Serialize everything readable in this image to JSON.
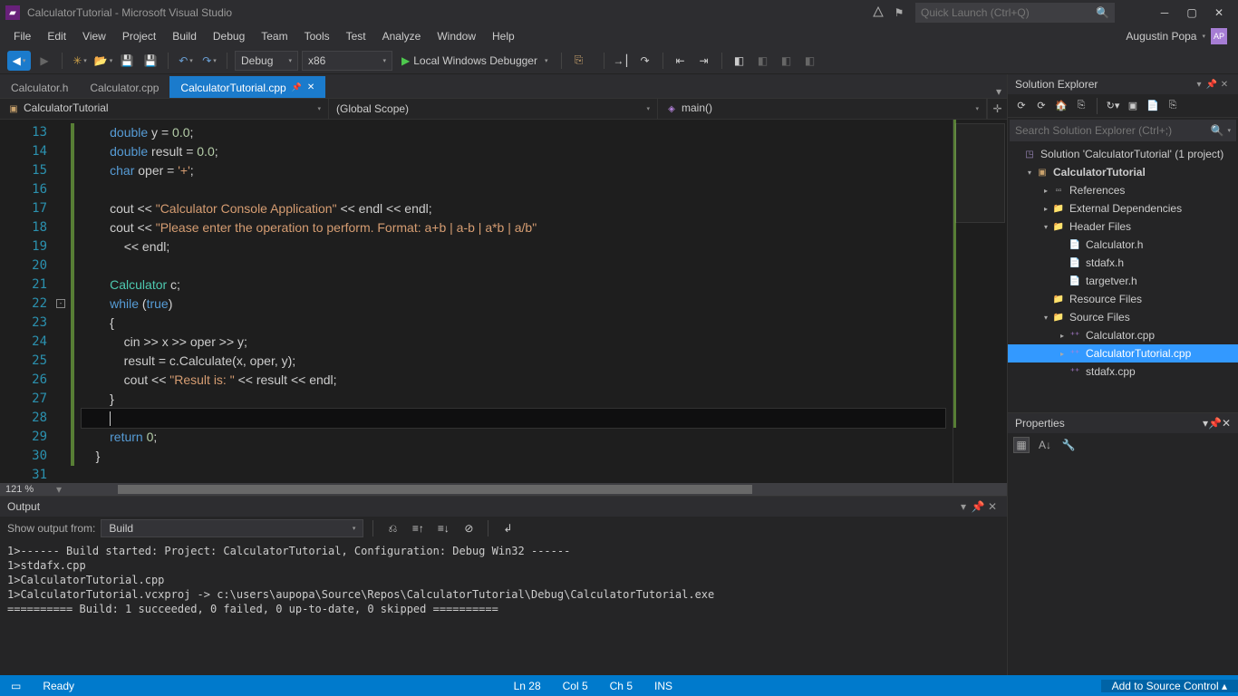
{
  "title": "CalculatorTutorial - Microsoft Visual Studio",
  "quickLaunch": {
    "placeholder": "Quick Launch (Ctrl+Q)"
  },
  "user": {
    "name": "Augustin Popa",
    "initials": "AP"
  },
  "menu": [
    "File",
    "Edit",
    "View",
    "Project",
    "Build",
    "Debug",
    "Team",
    "Tools",
    "Test",
    "Analyze",
    "Window",
    "Help"
  ],
  "toolbar": {
    "config": "Debug",
    "platform": "x86",
    "run": "Local Windows Debugger"
  },
  "tabs": [
    {
      "label": "Calculator.h",
      "active": false
    },
    {
      "label": "Calculator.cpp",
      "active": false
    },
    {
      "label": "CalculatorTutorial.cpp",
      "active": true
    }
  ],
  "nav": {
    "scope1": "CalculatorTutorial",
    "scope2": "(Global Scope)",
    "scope3": "main()"
  },
  "code": {
    "startLine": 13,
    "currentLine": 28,
    "lines": [
      {
        "n": 13,
        "mod": true,
        "html": "        <span class='kw'>double</span> y <span class='pl'>=</span> <span class='nm'>0.0</span><span class='pl'>;</span>"
      },
      {
        "n": 14,
        "mod": true,
        "html": "        <span class='kw'>double</span> result <span class='pl'>=</span> <span class='nm'>0.0</span><span class='pl'>;</span>"
      },
      {
        "n": 15,
        "mod": true,
        "html": "        <span class='kw'>char</span> oper <span class='pl'>=</span> <span class='st'>'+'</span><span class='pl'>;</span>"
      },
      {
        "n": 16,
        "mod": true,
        "html": ""
      },
      {
        "n": 17,
        "mod": true,
        "html": "        cout <span class='pl'>&lt;&lt;</span> <span class='st'>\"Calculator Console Application\"</span> <span class='pl'>&lt;&lt;</span> endl <span class='pl'>&lt;&lt;</span> endl<span class='pl'>;</span>"
      },
      {
        "n": 18,
        "mod": true,
        "html": "        cout <span class='pl'>&lt;&lt;</span> <span class='st'>\"Please enter the operation to perform. Format: a+b | a-b | a*b | a/b\"</span>"
      },
      {
        "n": 19,
        "mod": true,
        "html": "            <span class='pl'>&lt;&lt;</span> endl<span class='pl'>;</span>"
      },
      {
        "n": 20,
        "mod": true,
        "html": ""
      },
      {
        "n": 21,
        "mod": true,
        "html": "        <span class='ty'>Calculator</span> c<span class='pl'>;</span>"
      },
      {
        "n": 22,
        "mod": true,
        "fold": true,
        "html": "        <span class='kw'>while</span> <span class='pl'>(</span><span class='kw'>true</span><span class='pl'>)</span>"
      },
      {
        "n": 23,
        "mod": true,
        "html": "        <span class='pl'>{</span>"
      },
      {
        "n": 24,
        "mod": true,
        "html": "            cin <span class='pl'>&gt;&gt;</span> x <span class='pl'>&gt;&gt;</span> oper <span class='pl'>&gt;&gt;</span> y<span class='pl'>;</span>"
      },
      {
        "n": 25,
        "mod": true,
        "html": "            result <span class='pl'>=</span> c<span class='pl'>.</span>Calculate<span class='pl'>(</span>x<span class='pl'>,</span> oper<span class='pl'>,</span> y<span class='pl'>);</span>"
      },
      {
        "n": 26,
        "mod": true,
        "html": "            cout <span class='pl'>&lt;&lt;</span> <span class='st'>\"Result is: \"</span> <span class='pl'>&lt;&lt;</span> result <span class='pl'>&lt;&lt;</span> endl<span class='pl'>;</span>"
      },
      {
        "n": 27,
        "mod": true,
        "html": "        <span class='pl'>}</span>"
      },
      {
        "n": 28,
        "mod": true,
        "cur": true,
        "html": "        <span class='cursor'></span>"
      },
      {
        "n": 29,
        "mod": true,
        "html": "        <span class='kw'>return</span> <span class='nm'>0</span><span class='pl'>;</span>"
      },
      {
        "n": 30,
        "mod": true,
        "html": "    <span class='pl'>}</span>"
      },
      {
        "n": 31,
        "mod": false,
        "html": ""
      }
    ]
  },
  "zoom": "121 %",
  "output": {
    "title": "Output",
    "showFromLabel": "Show output from:",
    "showFrom": "Build",
    "lines": [
      "1>------ Build started: Project: CalculatorTutorial, Configuration: Debug Win32 ------",
      "1>stdafx.cpp",
      "1>CalculatorTutorial.cpp",
      "1>CalculatorTutorial.vcxproj -> c:\\users\\aupopa\\Source\\Repos\\CalculatorTutorial\\Debug\\CalculatorTutorial.exe",
      "========== Build: 1 succeeded, 0 failed, 0 up-to-date, 0 skipped =========="
    ]
  },
  "solutionExplorer": {
    "title": "Solution Explorer",
    "searchPlaceholder": "Search Solution Explorer (Ctrl+;)",
    "tree": [
      {
        "depth": 0,
        "arrow": "",
        "icon": "sln",
        "label": "Solution 'CalculatorTutorial' (1 project)"
      },
      {
        "depth": 1,
        "arrow": "▾",
        "icon": "proj",
        "label": "CalculatorTutorial",
        "bold": true
      },
      {
        "depth": 2,
        "arrow": "▸",
        "icon": "ref",
        "label": "References"
      },
      {
        "depth": 2,
        "arrow": "▸",
        "icon": "folder",
        "label": "External Dependencies"
      },
      {
        "depth": 2,
        "arrow": "▾",
        "icon": "folder",
        "label": "Header Files"
      },
      {
        "depth": 3,
        "arrow": "",
        "icon": "h",
        "label": "Calculator.h"
      },
      {
        "depth": 3,
        "arrow": "",
        "icon": "h",
        "label": "stdafx.h"
      },
      {
        "depth": 3,
        "arrow": "",
        "icon": "h",
        "label": "targetver.h"
      },
      {
        "depth": 2,
        "arrow": "",
        "icon": "folder",
        "label": "Resource Files"
      },
      {
        "depth": 2,
        "arrow": "▾",
        "icon": "folder",
        "label": "Source Files"
      },
      {
        "depth": 3,
        "arrow": "▸",
        "icon": "cpp",
        "label": "Calculator.cpp"
      },
      {
        "depth": 3,
        "arrow": "▸",
        "icon": "cpp",
        "label": "CalculatorTutorial.cpp",
        "sel": true
      },
      {
        "depth": 3,
        "arrow": "",
        "icon": "cpp",
        "label": "stdafx.cpp"
      }
    ]
  },
  "properties": {
    "title": "Properties"
  },
  "status": {
    "ready": "Ready",
    "ln": "Ln 28",
    "col": "Col 5",
    "ch": "Ch 5",
    "ins": "INS",
    "srcControl": "Add to Source Control ▴"
  }
}
